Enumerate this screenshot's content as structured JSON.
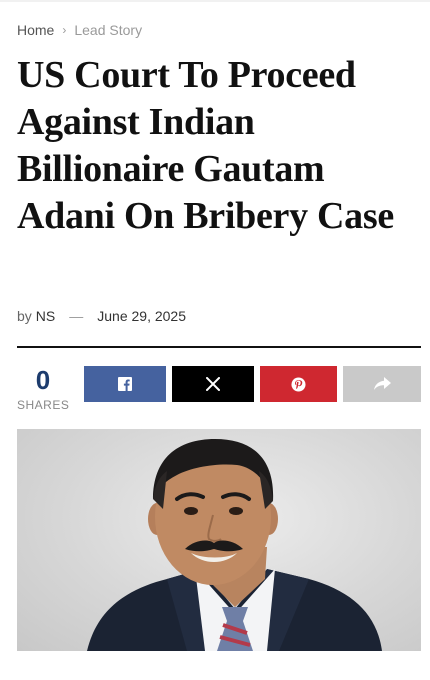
{
  "breadcrumb": {
    "home": "Home",
    "current": "Lead Story"
  },
  "article": {
    "title": "US Court To Proceed Against Indian Billionaire Gautam Adani On Bribery Case",
    "by": "by",
    "author": "NS",
    "date": "June 29, 2025"
  },
  "shares": {
    "count": "0",
    "label": "SHARES"
  },
  "share_buttons": [
    {
      "icon": "facebook-icon",
      "color": "#45629f"
    },
    {
      "icon": "x-icon",
      "color": "#000000"
    },
    {
      "icon": "pinterest-icon",
      "color": "#cf2830"
    },
    {
      "icon": "share-arrow-icon",
      "color": "#c9c9c9"
    }
  ],
  "colors": {
    "share_count": "#1d3c6d",
    "title": "#111111"
  }
}
